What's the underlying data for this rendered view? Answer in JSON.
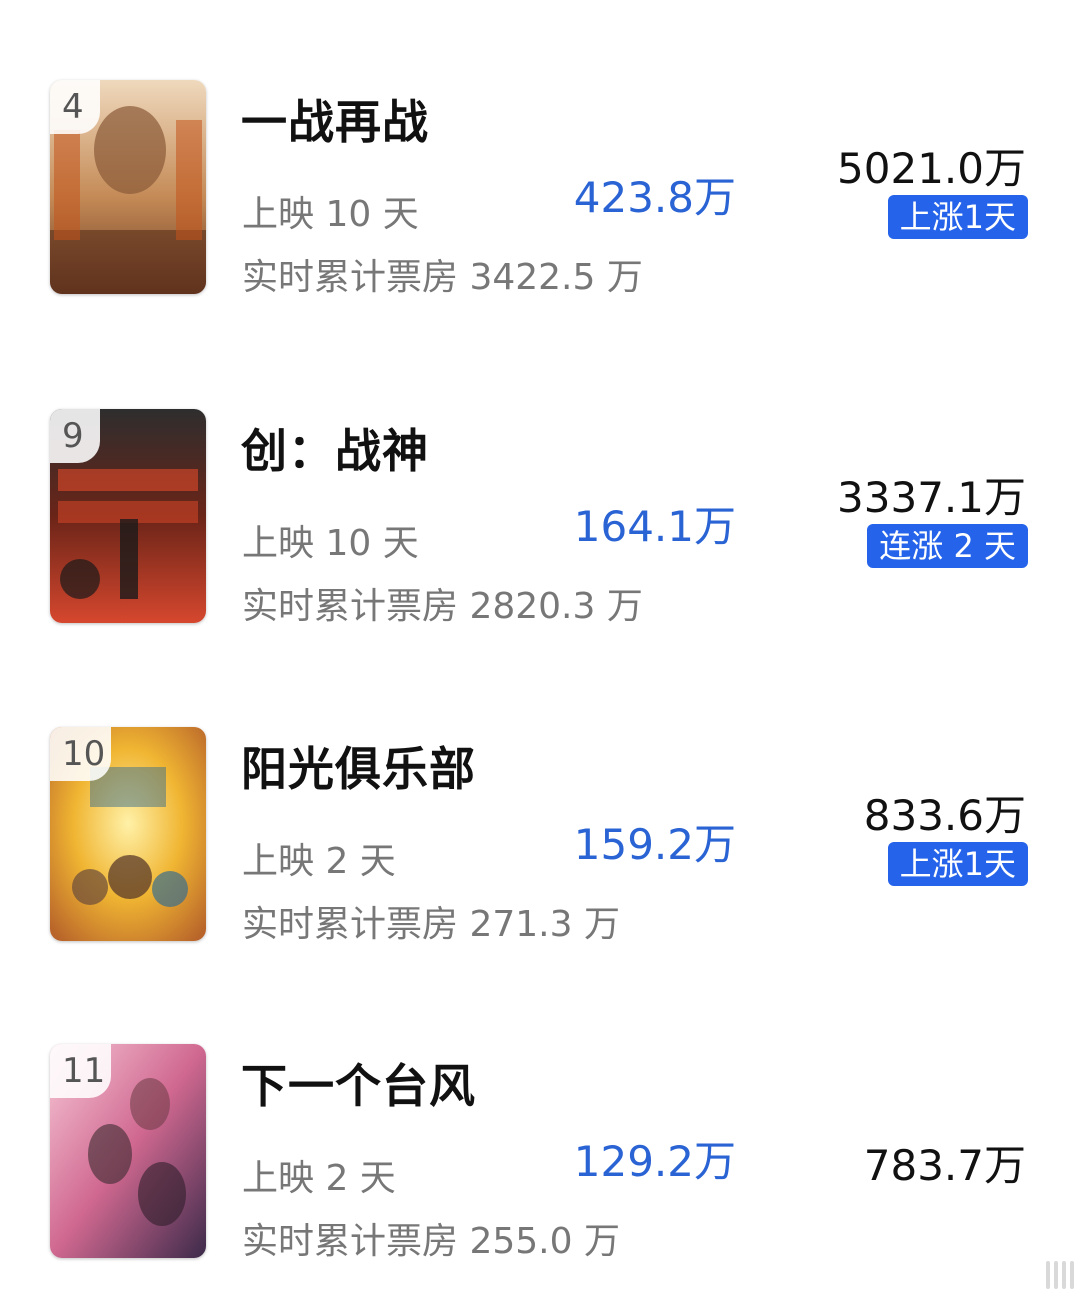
{
  "movies": [
    {
      "rank": "4",
      "title": "一战再战",
      "days": "上映 10 天",
      "cumulative": "实时累计票房 3422.5 万",
      "today": "423.8万",
      "total": "5021.0万",
      "badge": "上涨1天",
      "poster_colors": [
        "#e8c9a4",
        "#b06e3c",
        "#6b3a22"
      ]
    },
    {
      "rank": "9",
      "title": "创：战神",
      "days": "上映 10 天",
      "cumulative": "实时累计票房 2820.3 万",
      "today": "164.1万",
      "total": "3337.1万",
      "badge": "连涨 2 天",
      "poster_colors": [
        "#3a3a3a",
        "#8a2a1c",
        "#d2452e"
      ]
    },
    {
      "rank": "10",
      "title": "阳光俱乐部",
      "days": "上映 2 天",
      "cumulative": "实时累计票房 271.3 万",
      "today": "159.2万",
      "total": "833.6万",
      "badge": "上涨1天",
      "poster_colors": [
        "#f2c23a",
        "#d0842a",
        "#3a6e8c"
      ]
    },
    {
      "rank": "11",
      "title": "下一个台风",
      "days": "上映 2 天",
      "cumulative": "实时累计票房 255.0 万",
      "today": "129.2万",
      "total": "783.7万",
      "badge": "",
      "poster_colors": [
        "#f0b6c8",
        "#c04e7a",
        "#3c2a4a"
      ]
    }
  ],
  "colors": {
    "accent": "#2a63d4",
    "badge_bg": "#2563eb",
    "title": "#111111",
    "secondary": "#777777"
  }
}
